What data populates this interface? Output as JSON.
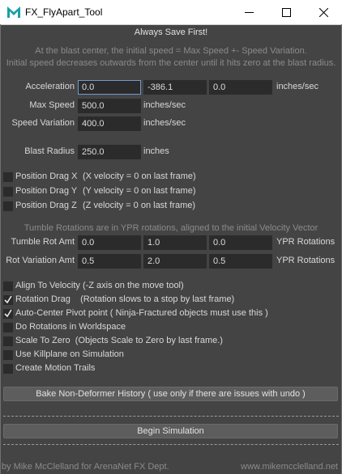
{
  "window": {
    "title": "FX_FlyApart_Tool"
  },
  "header": {
    "warning": "Always Save First!",
    "info_line1": "At the blast center, the initial speed = Max Speed +- Speed Variation.",
    "info_line2": "Initial speed decreases outwards from the center until it hits zero at the blast radius."
  },
  "acceleration": {
    "label": "Acceleration",
    "x": "0.0",
    "y": "-386.1",
    "z": "0.0",
    "unit": "inches/sec"
  },
  "max_speed": {
    "label": "Max Speed",
    "value": "500.0",
    "unit": "inches/sec"
  },
  "speed_variation": {
    "label": "Speed Variation",
    "value": "400.0",
    "unit": "inches/sec"
  },
  "blast_radius": {
    "label": "Blast Radius",
    "value": "250.0",
    "unit": "inches"
  },
  "position_drag": [
    {
      "label": "Position Drag X",
      "note": "(X velocity = 0 on last frame)",
      "checked": false
    },
    {
      "label": "Position Drag Y",
      "note": "(Y velocity = 0 on last frame)",
      "checked": false
    },
    {
      "label": "Position Drag Z",
      "note": "(Z velocity = 0 on last frame)",
      "checked": false
    }
  ],
  "tumble": {
    "note": "Tumble Rotations are in YPR rotations, aligned to the initial Velocity Vector",
    "amt_label": "Tumble Rot Amt",
    "amt": [
      "0.0",
      "1.0",
      "0.0"
    ],
    "amt_unit": "YPR Rotations",
    "var_label": "Rot Variation Amt",
    "var": [
      "0.5",
      "2.0",
      "0.5"
    ],
    "var_unit": "YPR Rotations"
  },
  "options": [
    {
      "label": "Align To Velocity (-Z axis on the move tool)",
      "checked": false
    },
    {
      "label": "Rotation Drag    (Rotation slows to a stop by last frame)",
      "checked": true
    },
    {
      "label": "Auto-Center Pivot point ( Ninja-Fractured objects must use this )",
      "checked": true
    },
    {
      "label": "Do Rotations in Worldspace",
      "checked": false
    },
    {
      "label": "Scale To Zero  (Objects Scale to Zero by last frame.)",
      "checked": false
    },
    {
      "label": "Use Killplane on Simulation",
      "checked": false
    },
    {
      "label": "Create Motion Trails",
      "checked": false
    }
  ],
  "buttons": {
    "bake": "Bake Non-Deformer History ( use only if there are issues with undo )",
    "begin": "Begin Simulation"
  },
  "footer": {
    "credit": "by Mike McClelland for ArenaNet FX Dept.",
    "website": "www.mikemcclelland.net"
  },
  "colors": {
    "background": "#444444",
    "field": "#2b2b2b",
    "focus_border": "#6d9bd0"
  }
}
